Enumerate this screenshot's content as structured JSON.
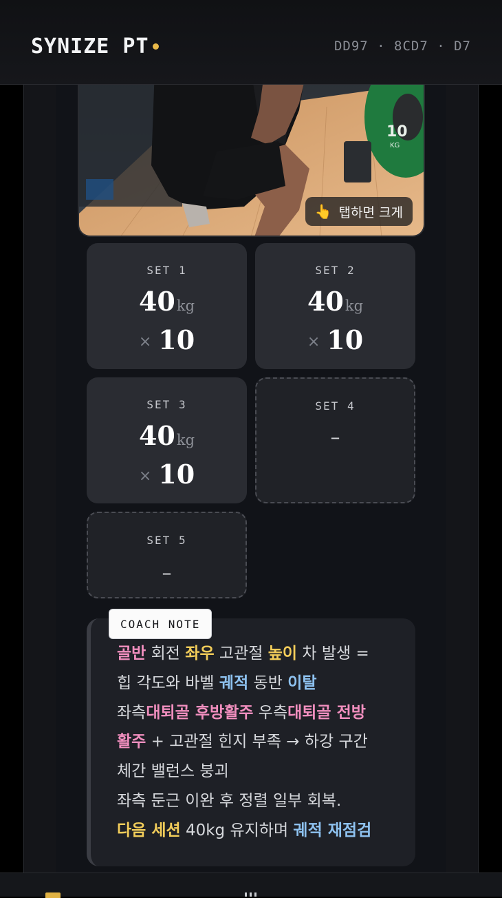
{
  "header": {
    "brand": "SYNIZE PT",
    "device_id": "DD97 · 8CD7 · D7"
  },
  "photo": {
    "tap_hint": "탭하면 크게",
    "plate_label": "10",
    "plate_unit": "KG"
  },
  "sets": [
    {
      "label": "SET 1",
      "weight": "40",
      "unit": "kg",
      "reps_prefix": "×",
      "reps": "10",
      "empty": false
    },
    {
      "label": "SET 2",
      "weight": "40",
      "unit": "kg",
      "reps_prefix": "×",
      "reps": "10",
      "empty": false
    },
    {
      "label": "SET 3",
      "weight": "40",
      "unit": "kg",
      "reps_prefix": "×",
      "reps": "10",
      "empty": false
    },
    {
      "label": "SET 4",
      "placeholder": "–",
      "empty": true
    },
    {
      "label": "SET 5",
      "placeholder": "–",
      "empty": true
    }
  ],
  "coach_note": {
    "badge": "COACH NOTE",
    "lines": [
      [
        {
          "t": "골반",
          "s": "pink"
        },
        {
          "t": " 회전 "
        },
        {
          "t": "좌우",
          "s": "yellow"
        },
        {
          "t": " 고관절 "
        },
        {
          "t": "높이",
          "s": "yellow"
        },
        {
          "t": " 차 발생 ="
        }
      ],
      [
        {
          "t": "힙 각도와 바벨 "
        },
        {
          "t": "궤적",
          "s": "blue"
        },
        {
          "t": " 동반 "
        },
        {
          "t": "이탈",
          "s": "blue"
        }
      ],
      [
        {
          "t": "좌측"
        },
        {
          "t": "대퇴골 후방활주",
          "s": "pink"
        },
        {
          "t": " 우측"
        },
        {
          "t": "대퇴골 전방",
          "s": "pink"
        }
      ],
      [
        {
          "t": "활주",
          "s": "pink"
        },
        {
          "t": " + 고관절 힌지 부족 → 하강 구간"
        }
      ],
      [
        {
          "t": "체간 밸런스 붕괴"
        }
      ],
      [
        {
          "t": "좌측 둔근 이완 후 정렬 일부 회복."
        }
      ],
      [
        {
          "t": "다음 세션",
          "s": "yellow"
        },
        {
          "t": " 40kg 유지하며 "
        },
        {
          "t": "궤적 재점검",
          "s": "blue"
        }
      ]
    ]
  },
  "colors": {
    "accent_yellow": "#e9b949",
    "highlight_pink": "#f28fbf",
    "highlight_yellow": "#f3cd5a",
    "highlight_blue": "#8ec2f0",
    "plate_green": "#1f7a3e"
  }
}
